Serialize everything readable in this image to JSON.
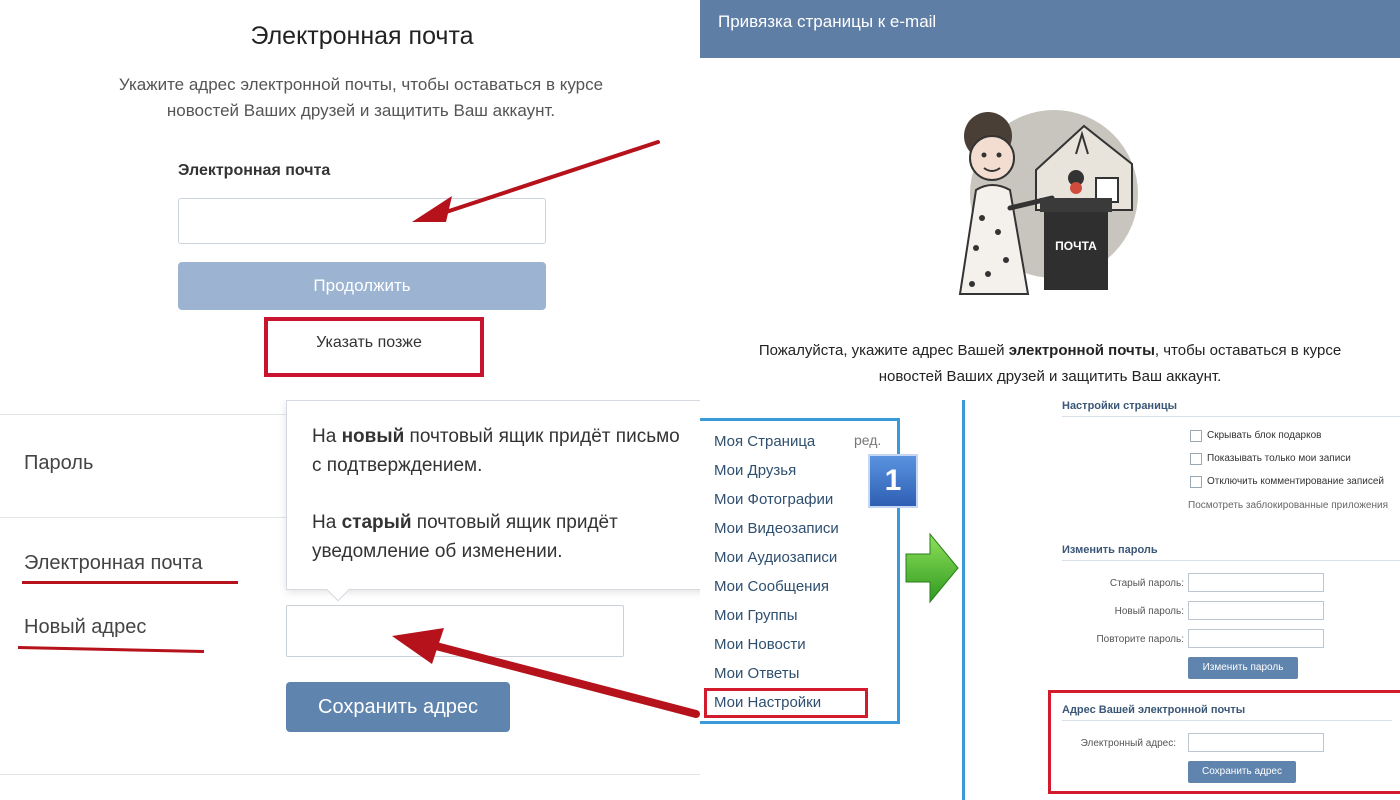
{
  "top_left": {
    "title": "Электронная почта",
    "description_line1": "Укажите адрес электронной почты, чтобы оставаться в курсе",
    "description_line2": "новостей Ваших друзей и защитить Ваш аккаунт.",
    "field_label": "Электронная почта",
    "field_value": "",
    "continue_label": "Продолжить",
    "later_label": "Указать позже"
  },
  "top_right": {
    "header_title": "Привязка страницы к e-mail",
    "mailbox_label": "ПОЧТА",
    "text_part1": "Пожалуйста, укажите адрес Вашей ",
    "text_bold": "электронной почты",
    "text_part2": ", чтобы оставаться в курсе",
    "text_line2": "новостей Ваших друзей и защитить Ваш аккаунт."
  },
  "bottom_left": {
    "password_label": "Пароль",
    "email_label": "Электронная почта",
    "new_address_label": "Новый адрес",
    "new_address_value": "",
    "tooltip": {
      "line1_prefix": "На ",
      "line1_bold": "новый",
      "line1_suffix": " почтовый ящик придёт письмо",
      "line2": "с подтверждением.",
      "line3_prefix": "На ",
      "line3_bold": "старый",
      "line3_suffix": " почтовый ящик придёт",
      "line4": "уведомление об изменении."
    },
    "save_label": "Сохранить адрес"
  },
  "bottom_right": {
    "menu_items": [
      "Моя Страница",
      "Мои Друзья",
      "Мои Фотографии",
      "Мои Видеозаписи",
      "Мои Аудиозаписи",
      "Мои Сообщения",
      "Мои Группы",
      "Мои Новости",
      "Мои Ответы",
      "Мои Настройки"
    ],
    "edit_label": "ред.",
    "step_badge": "1",
    "page_settings": {
      "title": "Настройки страницы",
      "options": [
        "Скрывать блок подарков",
        "Показывать только мои записи",
        "Отключить комментирование записей"
      ],
      "blocked_apps_link": "Посмотреть заблокированные приложения"
    },
    "change_password": {
      "title": "Изменить пароль",
      "old_label": "Старый пароль:",
      "new_label": "Новый пароль:",
      "repeat_label": "Повторите пароль:",
      "button_label": "Изменить пароль"
    },
    "email_section": {
      "title": "Адрес Вашей электронной почты",
      "email_label": "Электронный адрес:",
      "button_label": "Сохранить адрес"
    }
  },
  "colors": {
    "vk_header": "#5f7ea6",
    "vk_button": "#5f84ad",
    "vk_button_disabled": "#9cb4d2",
    "highlight_red": "#c8142f",
    "frame_blue": "#3a9ad9",
    "arrow_green": "#49b82f"
  }
}
